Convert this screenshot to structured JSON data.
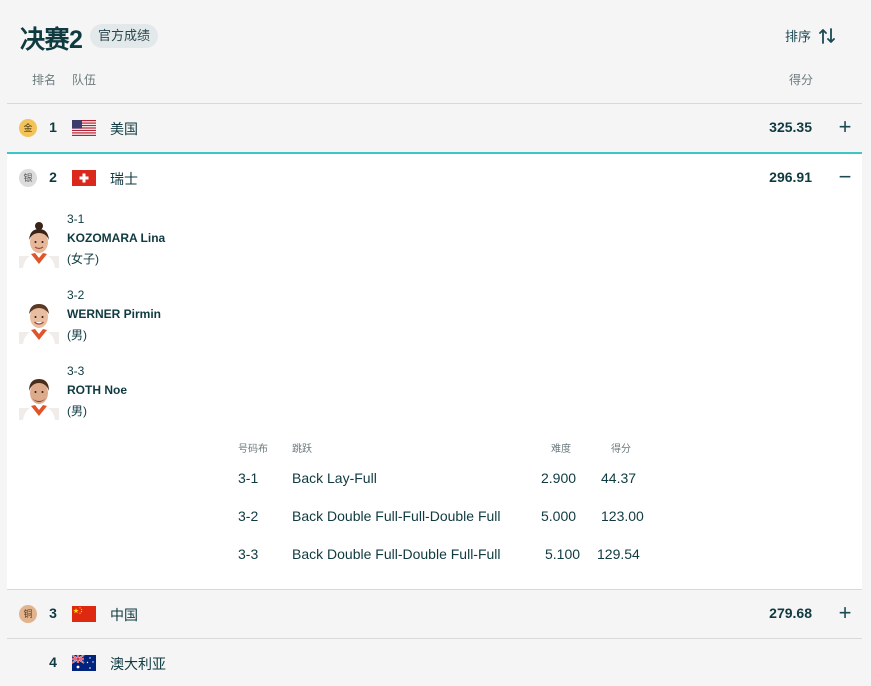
{
  "header": {
    "title": "决赛2",
    "badge": "官方成绩",
    "sort_label": "排序",
    "col_rank": "排名",
    "col_team": "队伍",
    "col_score": "得分"
  },
  "teams": [
    {
      "medal": "金",
      "rank": "1",
      "name": "美国",
      "score": "325.35",
      "toggle": "+"
    },
    {
      "medal": "银",
      "rank": "2",
      "name": "瑞士",
      "score": "296.91",
      "toggle": "−"
    },
    {
      "medal": "铜",
      "rank": "3",
      "name": "中国",
      "score": "279.68",
      "toggle": "+"
    },
    {
      "medal": "",
      "rank": "4",
      "name": "澳大利亚",
      "score": "",
      "toggle": ""
    }
  ],
  "athletes": [
    {
      "code": "3-1",
      "name": "KOZOMARA Lina",
      "gender": "(女子)"
    },
    {
      "code": "3-2",
      "name": "WERNER Pirmin",
      "gender": "(男)"
    },
    {
      "code": "3-3",
      "name": "ROTH Noe",
      "gender": "(男)"
    }
  ],
  "jumps_header": {
    "bib": "号码布",
    "jump": "跳跃",
    "difficulty": "难度",
    "score": "得分"
  },
  "jumps": [
    {
      "bib": "3-1",
      "jump": "Back Lay-Full",
      "difficulty": "2.900",
      "score": "44.37"
    },
    {
      "bib": "3-2",
      "jump": "Back Double Full-Full-Double Full",
      "difficulty": "5.000",
      "score": "123.00"
    },
    {
      "bib": "3-3",
      "jump": "Back Double Full-Double Full-Full",
      "difficulty": "5.100",
      "score": "129.54"
    }
  ],
  "colors": {
    "accent": "#3ec6c6",
    "text": "#0f3a40",
    "gold": "#f2c35a",
    "silver": "#dcdcdc",
    "bronze": "#e2b48e"
  }
}
